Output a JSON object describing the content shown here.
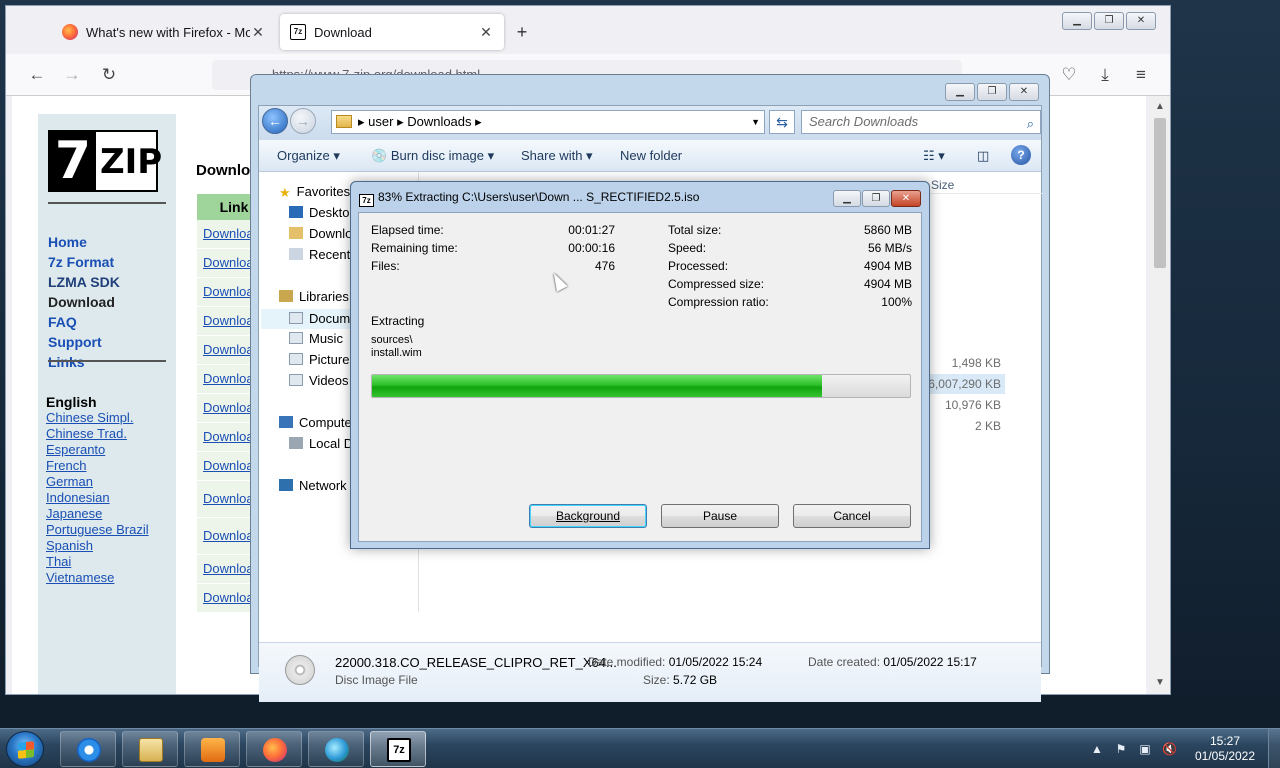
{
  "firefox": {
    "tabs": [
      {
        "title": "What's new with Firefox - More"
      },
      {
        "title": "Download"
      }
    ],
    "url": "https://www.7-zip.org/download.html"
  },
  "website": {
    "logo_text": "ZIP",
    "logo_digit": "7",
    "nav": [
      "Home",
      "7z Format",
      "LZMA SDK",
      "Download",
      "FAQ",
      "Support",
      "Links"
    ],
    "languages_heading": "English",
    "languages": [
      "Chinese Simpl.",
      "Chinese Trad.",
      "Esperanto",
      "French",
      "German",
      "Indonesian",
      "Japanese",
      "Portuguese Brazil",
      "Spanish",
      "Thai",
      "Vietnamese"
    ],
    "main_title": "Downloa",
    "link_header": "Link",
    "download_links": [
      "Downloa",
      "Downloa",
      "Downloa",
      "Downloa",
      "Downloa",
      "Downloa",
      "Downloa",
      "Downloa",
      "Downloa",
      "Downloa",
      "Downloa",
      "Downloa",
      "Downloa",
      "Downloa"
    ]
  },
  "explorer": {
    "path": [
      "user",
      "Downloads"
    ],
    "search_placeholder": "Search Downloads",
    "toolbar": {
      "organize": "Organize",
      "burn": "Burn disc image",
      "share": "Share with",
      "new_folder": "New folder"
    },
    "nav_pane": {
      "favorites": "Favorites",
      "desktop": "Desktop",
      "downloads": "Downlo",
      "recent": "Recent P",
      "libraries": "Libraries",
      "documents": "Docume",
      "music": "Music",
      "pictures": "Pictures",
      "videos": "Videos",
      "computer": "Compute",
      "local_disk": "Local Di",
      "network": "Network"
    },
    "column_size": "Size",
    "file_sizes": [
      "1,498 KB",
      "6,007,290 KB",
      "10,976 KB",
      "2 KB"
    ],
    "details": {
      "name": "22000.318.CO_RELEASE_CLIPRO_RET_X64...",
      "type": "Disc Image File",
      "date_modified_label": "Date modified:",
      "date_modified": "01/05/2022 15:24",
      "date_created_label": "Date created:",
      "date_created": "01/05/2022 15:17",
      "size_label": "Size:",
      "size": "5.72 GB"
    }
  },
  "progress_dialog": {
    "title": "83% Extracting C:\\Users\\user\\Down ... S_RECTIFIED2.5.iso",
    "elapsed_label": "Elapsed time:",
    "elapsed": "00:01:27",
    "remaining_label": "Remaining time:",
    "remaining": "00:00:16",
    "files_label": "Files:",
    "files": "476",
    "total_size_label": "Total size:",
    "total_size": "5860 MB",
    "speed_label": "Speed:",
    "speed": "56 MB/s",
    "processed_label": "Processed:",
    "processed": "4904 MB",
    "compressed_size_label": "Compressed size:",
    "compressed_size": "4904 MB",
    "ratio_label": "Compression ratio:",
    "ratio": "100%",
    "status": "Extracting",
    "current_dir": "sources\\",
    "current_file": "install.wim",
    "progress_fraction": 0.837,
    "buttons": {
      "background": "Background",
      "pause": "Pause",
      "cancel": "Cancel"
    }
  },
  "taskbar": {
    "time": "15:27",
    "date": "01/05/2022",
    "pinned": [
      "internet-explorer",
      "windows-explorer",
      "media-player",
      "firefox",
      "download-manager",
      "7-zip"
    ]
  }
}
